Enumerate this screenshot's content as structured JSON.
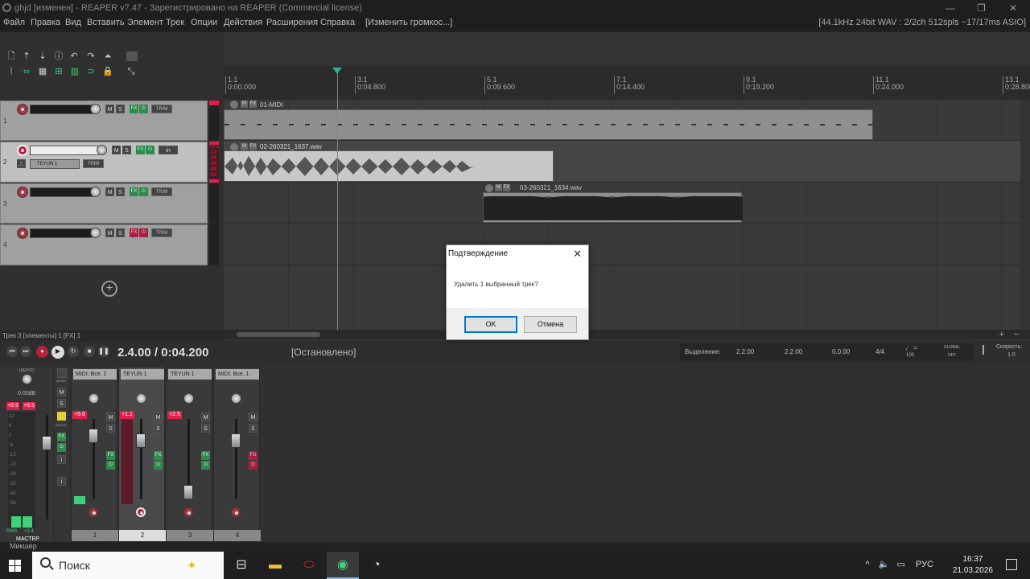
{
  "window": {
    "title": "ghjd [изменен] - REAPER v7.47 - Зарегистрировано на REAPER (Commercial license)"
  },
  "menu": {
    "items": [
      "Файл",
      "Правка",
      "Вид",
      "Вставить",
      "Элемент",
      "Трек",
      "Опции",
      "Действия",
      "Расширения",
      "Справка"
    ],
    "action_hint": "[Изменить громкос...]",
    "audio_info": "[44.1kHz 24bit WAV : 2/2ch 512spls ~17/17ms ASIO]"
  },
  "ruler": {
    "labels": [
      {
        "bar": "1.1",
        "time": "0:00.000"
      },
      {
        "bar": "3.1",
        "time": "0:04.800"
      },
      {
        "bar": "5.1",
        "time": "0:09.600"
      },
      {
        "bar": "7.1",
        "time": "0:14.400"
      },
      {
        "bar": "9.1",
        "time": "0:19.200"
      },
      {
        "bar": "11.1",
        "time": "0:24.000"
      },
      {
        "bar": "13.1",
        "time": "0:28.800"
      }
    ]
  },
  "tracks": [
    {
      "num": "1",
      "in_label": "",
      "sel": false
    },
    {
      "num": "2",
      "in_label": "in",
      "sub_name": "TEYUN 1",
      "sel": true
    },
    {
      "num": "3",
      "in_label": "",
      "sel": false
    },
    {
      "num": "4",
      "in_label": "",
      "sel": false
    }
  ],
  "track_buttons": {
    "mute": "M",
    "solo": "S",
    "fx": "FX",
    "trim": "TRIM"
  },
  "track2_meter": [
    "+1.1",
    "-12",
    "-24",
    "-36",
    "-48",
    "-54"
  ],
  "items": {
    "midi": "01-MIDI",
    "wav1": "02-260321_1637.wav",
    "wav2": "03-260321_1634.wav"
  },
  "status_bar": "Трек 3 [элементы] 1 [FX] 1",
  "transport": {
    "position": "2.4.00 / 0:04.200",
    "state": "[Остановлено]",
    "selection_label": "Выделение:",
    "sel_start": "2.2.00",
    "sel_end": "2.2.00",
    "sel_len": "0.0.00",
    "time_sig": "4/4",
    "bpm": "100",
    "global": "GLOBAL",
    "global_state": "OFF",
    "rate_label": "Скорость:",
    "rate": "1.0"
  },
  "mixer": {
    "master_label": "МАСТЕР",
    "master_top": "ШЕНТО",
    "master_vol": "0.00dB",
    "master_vol_l": "+9.5",
    "master_vol_r": "+9.5",
    "master_rms_l": "RMS",
    "master_rms_r": "+2.4",
    "mono": "MONO",
    "route": "ROUTE",
    "strips": [
      {
        "name": "MIDI: Всe. 1",
        "vol": "+9.6",
        "num": "1"
      },
      {
        "name": "TEYUN 1",
        "vol": "+1.1",
        "num": "2"
      },
      {
        "name": "TEYUN 1",
        "vol": "+2.5",
        "num": "3"
      },
      {
        "name": "MIDI: Всe. 1",
        "vol": "",
        "num": "4"
      }
    ],
    "panel_label": "Микшер"
  },
  "dialog": {
    "title": "Подтверждение",
    "message": "Удалить 1 выбранный трек?",
    "ok": "OK",
    "cancel": "Отмена"
  },
  "taskbar": {
    "search": "Поиск",
    "lang": "РУС",
    "time": "16:37",
    "date": "21.03.2026"
  }
}
